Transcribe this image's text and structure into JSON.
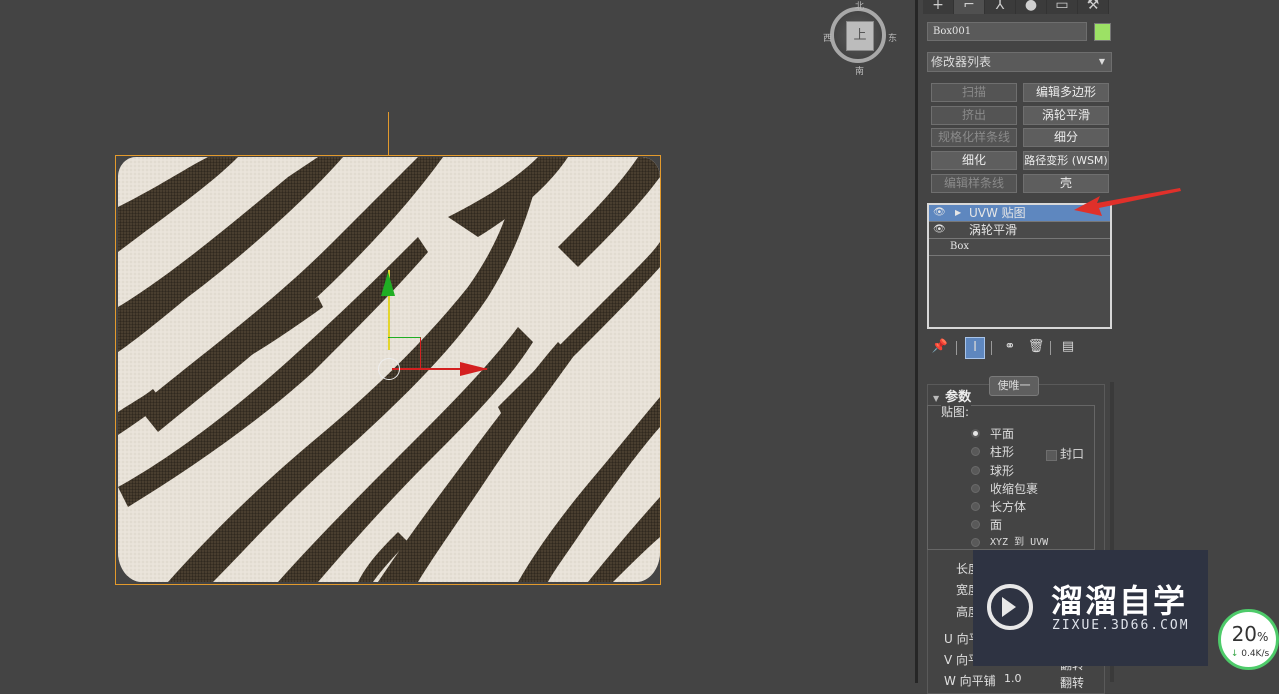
{
  "viewcube": {
    "face": "上",
    "north": "北",
    "south": "南",
    "east": "东",
    "west": "西"
  },
  "panel": {
    "tabs": [
      "+",
      "⌐",
      "⅄",
      "●",
      "▭",
      "⚒"
    ],
    "object_name": "Box001",
    "object_color": "#9ce165",
    "modifier_list": "修改器列表",
    "modifier_buttons": [
      {
        "label": "扫描",
        "enabled": false
      },
      {
        "label": "编辑多边形",
        "enabled": true
      },
      {
        "label": "挤出",
        "enabled": false
      },
      {
        "label": "涡轮平滑",
        "enabled": true
      },
      {
        "label": "规格化样条线",
        "enabled": false
      },
      {
        "label": "细分",
        "enabled": true
      },
      {
        "label": "细化",
        "enabled": true
      },
      {
        "label": "路径变形 (WSM)",
        "enabled": true
      },
      {
        "label": "编辑样条线",
        "enabled": false
      },
      {
        "label": "壳",
        "enabled": true
      }
    ],
    "stack": [
      {
        "label": "UVW 贴图",
        "selected": true
      },
      {
        "label": "涡轮平滑",
        "selected": false
      },
      {
        "label": "Box",
        "selected": false
      }
    ],
    "tooltip": "使唯一",
    "rollout": {
      "title": "参数",
      "group_label": "贴图:",
      "options": [
        "平面",
        "柱形",
        "球形",
        "收缩包裹",
        "长方体",
        "面",
        "XYZ 到 UVW"
      ],
      "selected_option": "平面",
      "cap_label": "封口",
      "fields": [
        "长度",
        "宽度",
        "高度",
        "U 向平",
        "V 向平",
        "W 向平铺",
        "1.0",
        "翻转",
        "翻转"
      ]
    }
  },
  "watermark": {
    "brand": "溜溜自学",
    "url": "ZIXUE.3D66.COM"
  },
  "net_badge": {
    "percent": "20",
    "percent_sign": "%",
    "rate": "0.4K/s"
  },
  "accent": "#5e87bf",
  "selection_color": "#e39a2c"
}
